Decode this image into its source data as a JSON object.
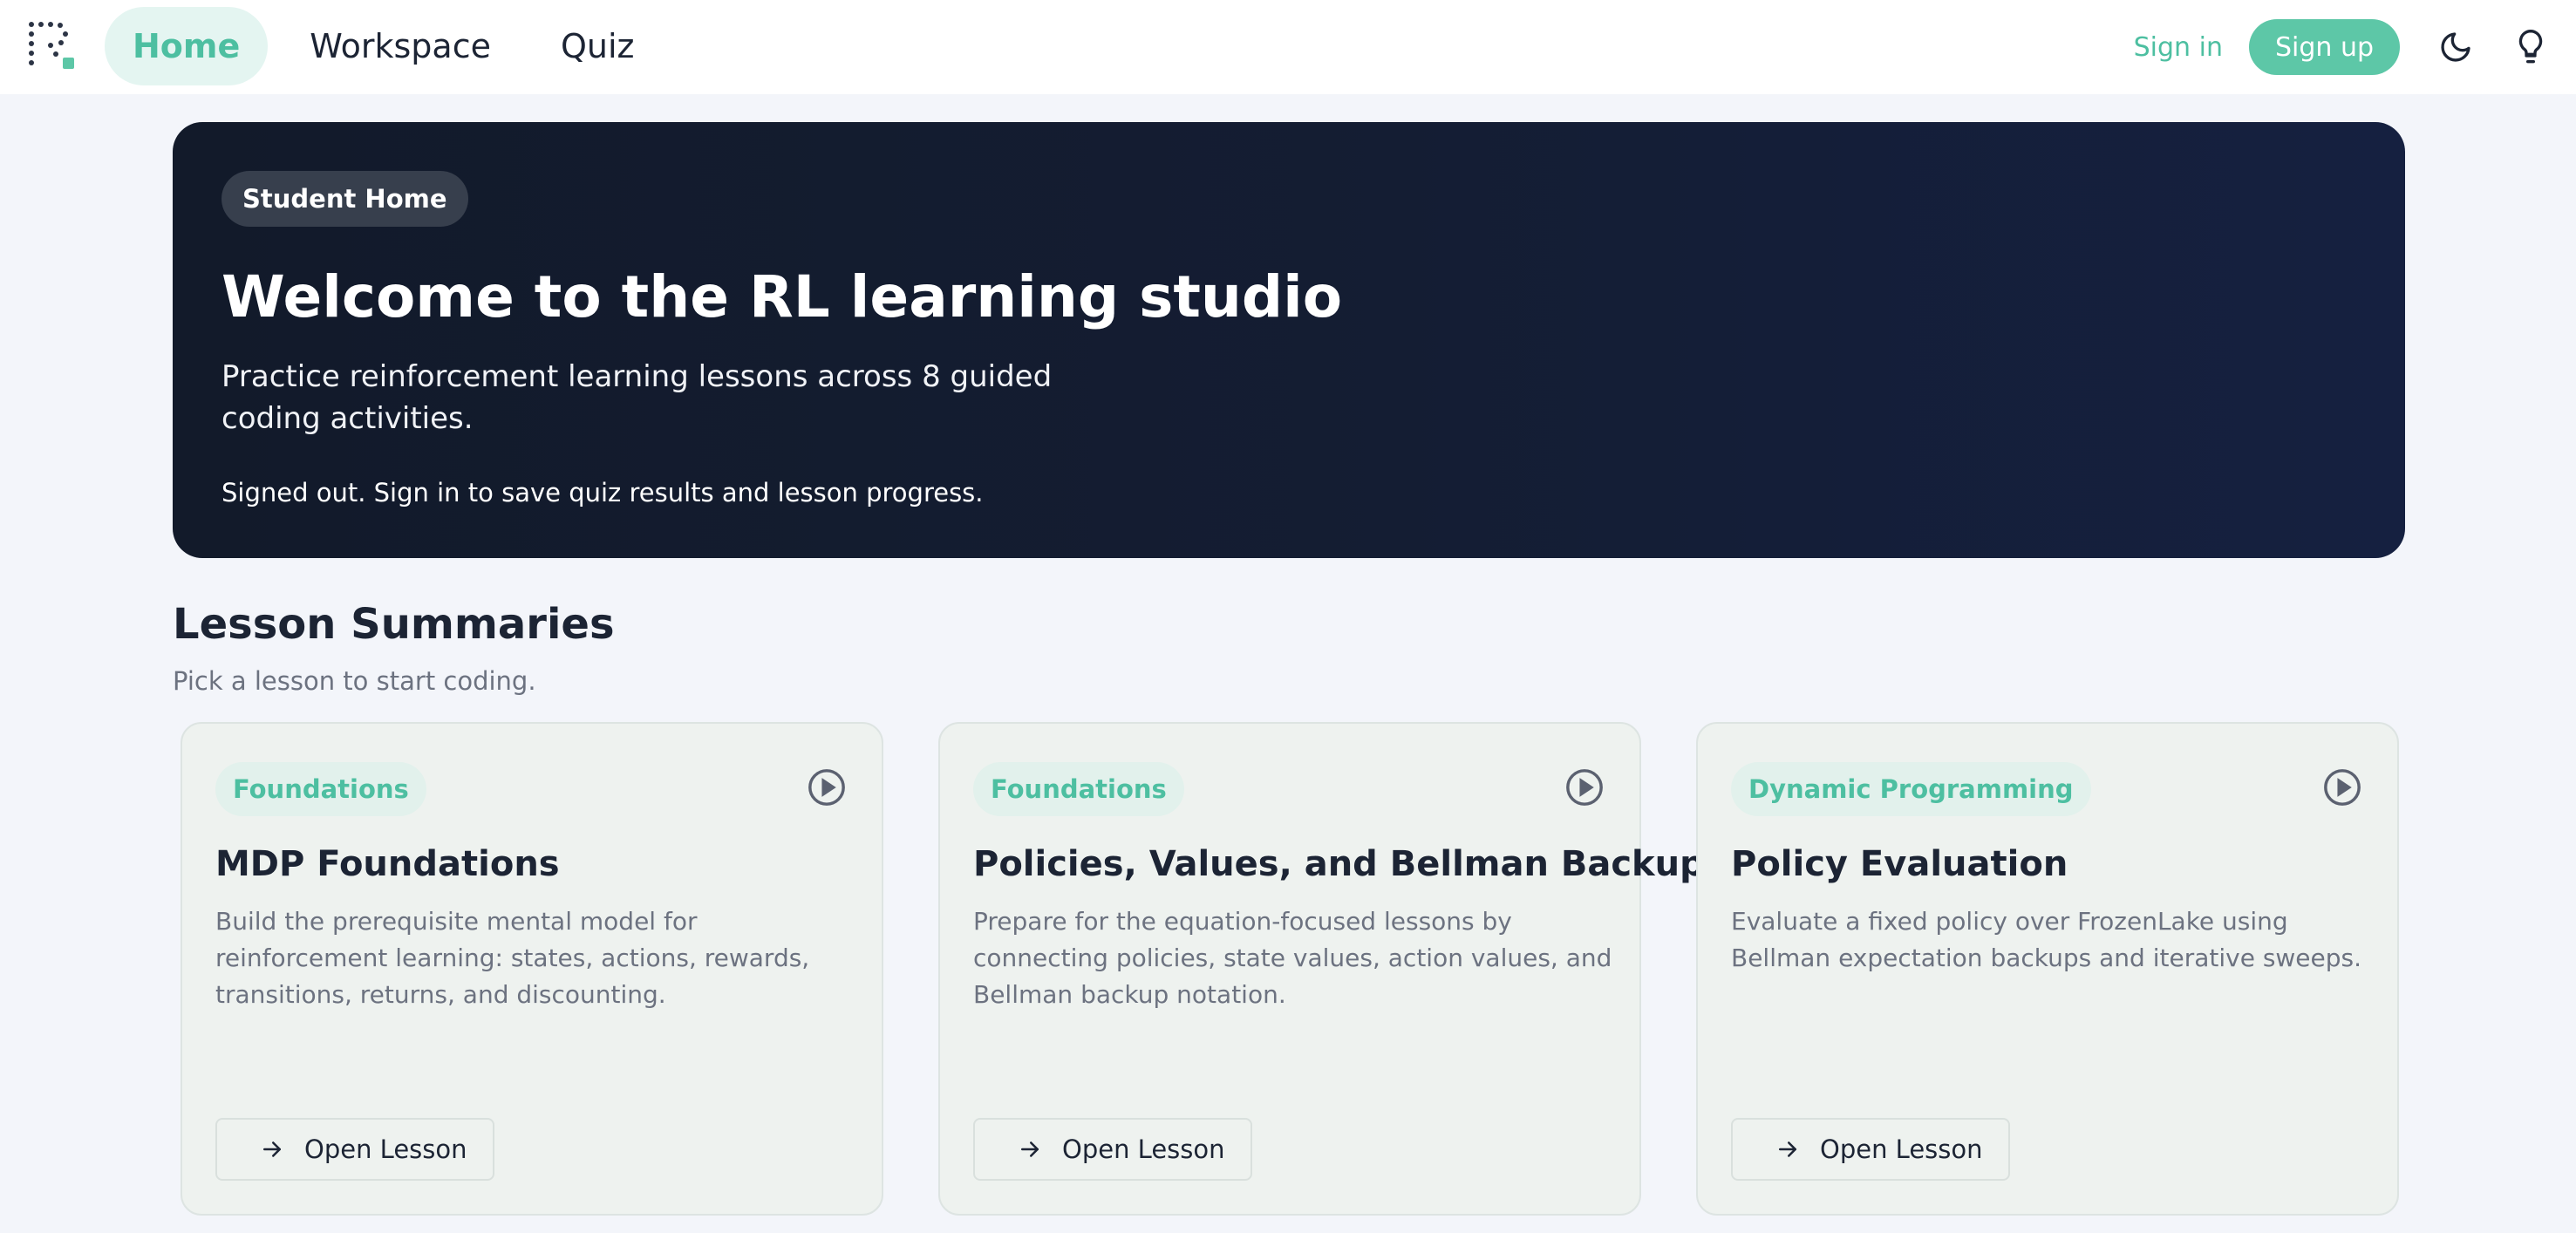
{
  "nav": {
    "tabs": [
      {
        "label": "Home",
        "active": true
      },
      {
        "label": "Workspace",
        "active": false
      },
      {
        "label": "Quiz",
        "active": false
      }
    ],
    "sign_in": "Sign in",
    "sign_up": "Sign up",
    "icons": [
      "moon-icon",
      "lightbulb-icon"
    ]
  },
  "hero": {
    "badge": "Student Home",
    "title": "Welcome to the RL learning studio",
    "subtitle": "Practice reinforcement learning lessons across 8 guided coding activities.",
    "note": "Signed out. Sign in to save quiz results and lesson progress."
  },
  "section": {
    "title": "Lesson Summaries",
    "subtitle": "Pick a lesson to start coding."
  },
  "lessons": [
    {
      "tag": "Foundations",
      "title": "MDP Foundations",
      "description": "Build the prerequisite mental model for reinforcement learning: states, actions, rewards, transitions, returns, and discounting.",
      "button": "Open Lesson"
    },
    {
      "tag": "Foundations",
      "title": "Policies, Values, and Bellman Backups",
      "description": "Prepare for the equation-focused lessons by connecting policies, state values, action values, and Bellman backup notation.",
      "button": "Open Lesson"
    },
    {
      "tag": "Dynamic Programming",
      "title": "Policy Evaluation",
      "description": "Evaluate a fixed policy over FrozenLake using Bellman expectation backups and iterative sweeps.",
      "button": "Open Lesson"
    }
  ],
  "colors": {
    "accent": "#5dc7a7",
    "accent_text": "#4dbfa1",
    "hero_bg": "#131b30",
    "page_bg": "#f3f5fa"
  }
}
